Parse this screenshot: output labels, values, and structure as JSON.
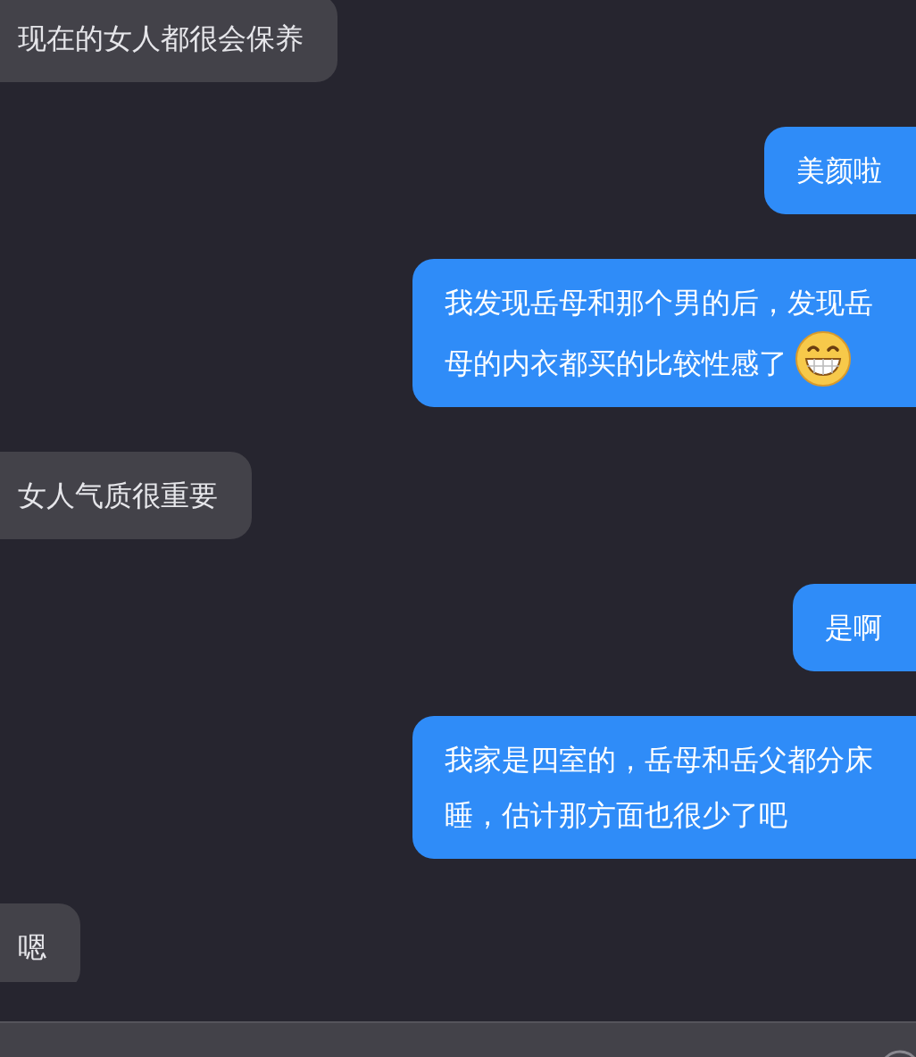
{
  "messages": [
    {
      "kind": "incoming",
      "text": "现在的女人都很会保养",
      "trailing_icon": false
    },
    {
      "kind": "outgoing",
      "text": "美颜啦",
      "trailing_icon": false
    },
    {
      "kind": "outgoing",
      "text": "我发现岳母和那个男的后，发现岳母的内衣都买的比较性感了",
      "trailing_icon": true
    },
    {
      "kind": "incoming",
      "text": "女人气质很重要",
      "trailing_icon": false
    },
    {
      "kind": "outgoing",
      "text": "是啊",
      "trailing_icon": false
    },
    {
      "kind": "outgoing",
      "text": "我家是四室的，岳母和岳父都分床睡，估计那方面也很少了吧",
      "trailing_icon": false
    },
    {
      "kind": "incoming",
      "text": "嗯",
      "trailing_icon": false
    }
  ]
}
